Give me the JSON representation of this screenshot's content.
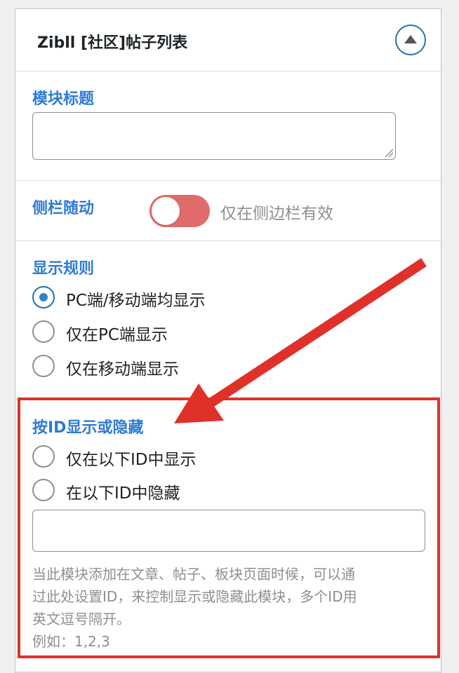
{
  "widget": {
    "title": "Zibll [社区]帖子列表"
  },
  "module_title": {
    "label": "模块标题",
    "value": ""
  },
  "sidebar_follow": {
    "label": "侧栏随动",
    "toggle_on": false,
    "hint": "仅在侧边栏有效"
  },
  "display_rule": {
    "label": "显示规则",
    "options": [
      {
        "label": "PC端/移动端均显示",
        "checked": true
      },
      {
        "label": "仅在PC端显示",
        "checked": false
      },
      {
        "label": "仅在移动端显示",
        "checked": false
      }
    ]
  },
  "id_visibility": {
    "label": "按ID显示或隐藏",
    "options": [
      {
        "label": "仅在以下ID中显示",
        "checked": false
      },
      {
        "label": "在以下ID中隐藏",
        "checked": false
      }
    ],
    "input_value": "",
    "help_line1": "当此模块添加在文章、帖子、板块页面时候，可以通",
    "help_line2": "过此处设置ID，来控制显示或隐藏此模块，多个ID用",
    "help_line3": "英文逗号隔开。",
    "example": "例如：1,2,3"
  },
  "colors": {
    "accent": "#2f7bd3",
    "toggle_off": "#e06b6b",
    "annotation_red": "#e0302a"
  }
}
